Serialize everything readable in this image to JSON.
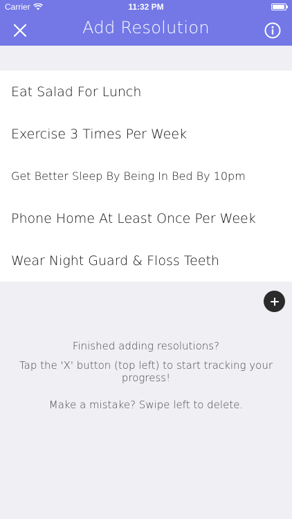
{
  "status_bar": {
    "carrier": "Carrier",
    "time": "11:32 PM"
  },
  "nav": {
    "title": "Add Resolution",
    "close_icon": "close-icon",
    "info_icon": "info-icon"
  },
  "resolutions": [
    {
      "label": "Eat Salad For Lunch"
    },
    {
      "label": "Exercise 3 Times Per Week"
    },
    {
      "label": "Get Better Sleep By Being In Bed By 10pm"
    },
    {
      "label": "Phone Home At Least Once Per Week"
    },
    {
      "label": "Wear Night Guard & Floss Teeth"
    }
  ],
  "add_button": {
    "icon": "plus-icon"
  },
  "hints": {
    "line1": "Finished adding resolutions?",
    "line2": "Tap the 'X' button (top left) to start tracking your progress!",
    "line3": "Make a mistake? Swipe left to delete."
  },
  "colors": {
    "accent": "#7378e6",
    "background": "#efeff4",
    "add_button": "#2b2b2b"
  }
}
